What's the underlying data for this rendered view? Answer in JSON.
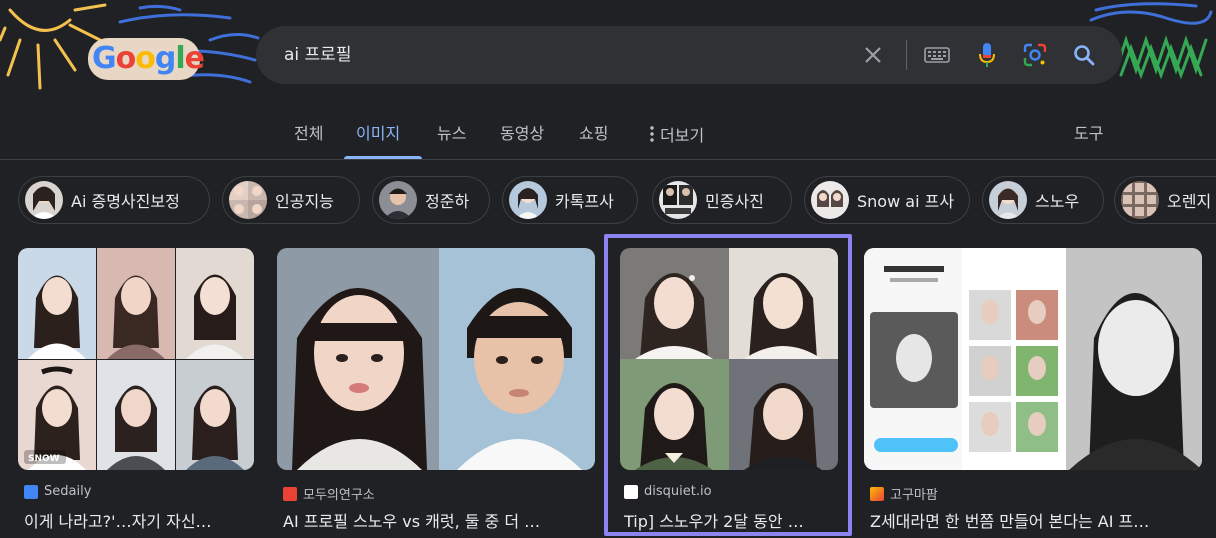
{
  "search": {
    "query": "ai 프로필"
  },
  "logo": {
    "text": "Google"
  },
  "tabs": [
    {
      "label": "전체",
      "active": false
    },
    {
      "label": "이미지",
      "active": true
    },
    {
      "label": "뉴스",
      "active": false
    },
    {
      "label": "동영상",
      "active": false
    },
    {
      "label": "쇼핑",
      "active": false
    },
    {
      "label": "더보기",
      "active": false
    }
  ],
  "tools_label": "도구",
  "chips": [
    {
      "label": "Ai 증명사진보정"
    },
    {
      "label": "인공지능"
    },
    {
      "label": "정준하"
    },
    {
      "label": "카톡프사"
    },
    {
      "label": "민증사진"
    },
    {
      "label": "Snow ai 프사"
    },
    {
      "label": "스노우"
    },
    {
      "label": "오렌지"
    }
  ],
  "results": [
    {
      "source": "Sedaily",
      "title": "이게 나라고?'…자기 자신…",
      "favicon_color": "#4285f4",
      "watermark": "SNOW"
    },
    {
      "source": "모두의연구소",
      "title": "AI 프로필 스노우 vs 캐럿, 둘 중 더 …",
      "favicon_color": "#ea4335"
    },
    {
      "source": "disquiet.io",
      "title": "Tip] 스노우가 2달 동안 …",
      "favicon_color": "#ffffff"
    },
    {
      "source": "고구마팜",
      "title": "Z세대라면 한 번쯤 만들어 본다는 AI 프…",
      "favicon_color": "#ea4335"
    }
  ],
  "colors": {
    "background": "#202124",
    "accent": "#8ab4f8",
    "highlight": "#8e84f1"
  }
}
